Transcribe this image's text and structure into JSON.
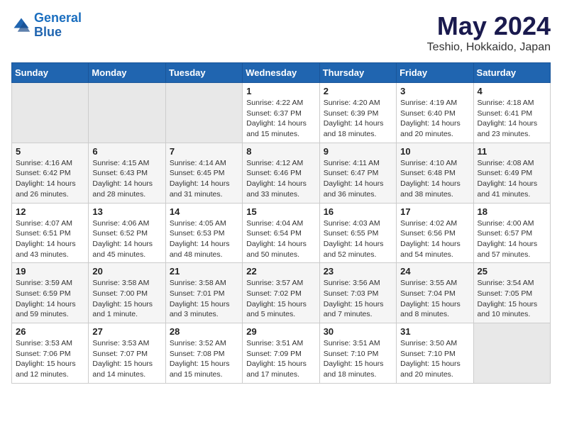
{
  "header": {
    "logo_line1": "General",
    "logo_line2": "Blue",
    "title": "May 2024",
    "subtitle": "Teshio, Hokkaido, Japan"
  },
  "days_of_week": [
    "Sunday",
    "Monday",
    "Tuesday",
    "Wednesday",
    "Thursday",
    "Friday",
    "Saturday"
  ],
  "weeks": [
    [
      {
        "num": "",
        "info": ""
      },
      {
        "num": "",
        "info": ""
      },
      {
        "num": "",
        "info": ""
      },
      {
        "num": "1",
        "info": "Sunrise: 4:22 AM\nSunset: 6:37 PM\nDaylight: 14 hours\nand 15 minutes."
      },
      {
        "num": "2",
        "info": "Sunrise: 4:20 AM\nSunset: 6:39 PM\nDaylight: 14 hours\nand 18 minutes."
      },
      {
        "num": "3",
        "info": "Sunrise: 4:19 AM\nSunset: 6:40 PM\nDaylight: 14 hours\nand 20 minutes."
      },
      {
        "num": "4",
        "info": "Sunrise: 4:18 AM\nSunset: 6:41 PM\nDaylight: 14 hours\nand 23 minutes."
      }
    ],
    [
      {
        "num": "5",
        "info": "Sunrise: 4:16 AM\nSunset: 6:42 PM\nDaylight: 14 hours\nand 26 minutes."
      },
      {
        "num": "6",
        "info": "Sunrise: 4:15 AM\nSunset: 6:43 PM\nDaylight: 14 hours\nand 28 minutes."
      },
      {
        "num": "7",
        "info": "Sunrise: 4:14 AM\nSunset: 6:45 PM\nDaylight: 14 hours\nand 31 minutes."
      },
      {
        "num": "8",
        "info": "Sunrise: 4:12 AM\nSunset: 6:46 PM\nDaylight: 14 hours\nand 33 minutes."
      },
      {
        "num": "9",
        "info": "Sunrise: 4:11 AM\nSunset: 6:47 PM\nDaylight: 14 hours\nand 36 minutes."
      },
      {
        "num": "10",
        "info": "Sunrise: 4:10 AM\nSunset: 6:48 PM\nDaylight: 14 hours\nand 38 minutes."
      },
      {
        "num": "11",
        "info": "Sunrise: 4:08 AM\nSunset: 6:49 PM\nDaylight: 14 hours\nand 41 minutes."
      }
    ],
    [
      {
        "num": "12",
        "info": "Sunrise: 4:07 AM\nSunset: 6:51 PM\nDaylight: 14 hours\nand 43 minutes."
      },
      {
        "num": "13",
        "info": "Sunrise: 4:06 AM\nSunset: 6:52 PM\nDaylight: 14 hours\nand 45 minutes."
      },
      {
        "num": "14",
        "info": "Sunrise: 4:05 AM\nSunset: 6:53 PM\nDaylight: 14 hours\nand 48 minutes."
      },
      {
        "num": "15",
        "info": "Sunrise: 4:04 AM\nSunset: 6:54 PM\nDaylight: 14 hours\nand 50 minutes."
      },
      {
        "num": "16",
        "info": "Sunrise: 4:03 AM\nSunset: 6:55 PM\nDaylight: 14 hours\nand 52 minutes."
      },
      {
        "num": "17",
        "info": "Sunrise: 4:02 AM\nSunset: 6:56 PM\nDaylight: 14 hours\nand 54 minutes."
      },
      {
        "num": "18",
        "info": "Sunrise: 4:00 AM\nSunset: 6:57 PM\nDaylight: 14 hours\nand 57 minutes."
      }
    ],
    [
      {
        "num": "19",
        "info": "Sunrise: 3:59 AM\nSunset: 6:59 PM\nDaylight: 14 hours\nand 59 minutes."
      },
      {
        "num": "20",
        "info": "Sunrise: 3:58 AM\nSunset: 7:00 PM\nDaylight: 15 hours\nand 1 minute."
      },
      {
        "num": "21",
        "info": "Sunrise: 3:58 AM\nSunset: 7:01 PM\nDaylight: 15 hours\nand 3 minutes."
      },
      {
        "num": "22",
        "info": "Sunrise: 3:57 AM\nSunset: 7:02 PM\nDaylight: 15 hours\nand 5 minutes."
      },
      {
        "num": "23",
        "info": "Sunrise: 3:56 AM\nSunset: 7:03 PM\nDaylight: 15 hours\nand 7 minutes."
      },
      {
        "num": "24",
        "info": "Sunrise: 3:55 AM\nSunset: 7:04 PM\nDaylight: 15 hours\nand 8 minutes."
      },
      {
        "num": "25",
        "info": "Sunrise: 3:54 AM\nSunset: 7:05 PM\nDaylight: 15 hours\nand 10 minutes."
      }
    ],
    [
      {
        "num": "26",
        "info": "Sunrise: 3:53 AM\nSunset: 7:06 PM\nDaylight: 15 hours\nand 12 minutes."
      },
      {
        "num": "27",
        "info": "Sunrise: 3:53 AM\nSunset: 7:07 PM\nDaylight: 15 hours\nand 14 minutes."
      },
      {
        "num": "28",
        "info": "Sunrise: 3:52 AM\nSunset: 7:08 PM\nDaylight: 15 hours\nand 15 minutes."
      },
      {
        "num": "29",
        "info": "Sunrise: 3:51 AM\nSunset: 7:09 PM\nDaylight: 15 hours\nand 17 minutes."
      },
      {
        "num": "30",
        "info": "Sunrise: 3:51 AM\nSunset: 7:10 PM\nDaylight: 15 hours\nand 18 minutes."
      },
      {
        "num": "31",
        "info": "Sunrise: 3:50 AM\nSunset: 7:10 PM\nDaylight: 15 hours\nand 20 minutes."
      },
      {
        "num": "",
        "info": ""
      }
    ]
  ]
}
